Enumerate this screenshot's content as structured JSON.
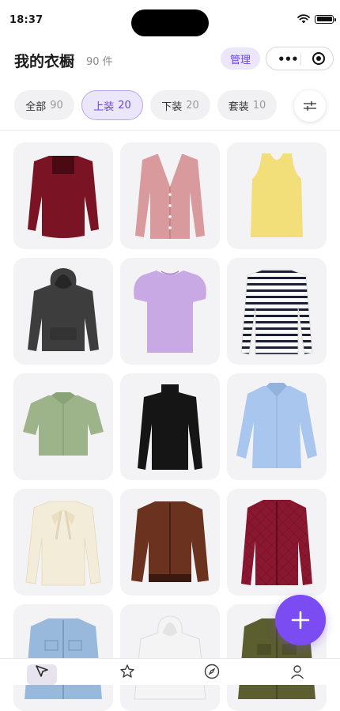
{
  "status": {
    "time": "18:37"
  },
  "header": {
    "title": "我的衣橱",
    "count": "90 件",
    "manage_label": "管理"
  },
  "tabs": [
    {
      "label": "全部",
      "count": "90"
    },
    {
      "label": "上装",
      "count": "20"
    },
    {
      "label": "下装",
      "count": "20"
    },
    {
      "label": "套装",
      "count": "10"
    }
  ],
  "active_tab": "上装",
  "items": [
    {
      "name": "burgundy-velvet-top-image",
      "color": "#7a1424"
    },
    {
      "name": "pink-knit-cardigan-image",
      "color": "#d99a9e"
    },
    {
      "name": "yellow-tank-top-image",
      "color": "#f3df7a"
    },
    {
      "name": "gray-hoodie-image",
      "color": "#3d3d3d"
    },
    {
      "name": "lavender-puff-sleeve-top-image",
      "color": "#c9a9e3"
    },
    {
      "name": "striped-long-sleeve-tee-image",
      "color": "#1b1f36"
    },
    {
      "name": "sage-green-shirt-image",
      "color": "#9db38a"
    },
    {
      "name": "black-turtleneck-image",
      "color": "#151515"
    },
    {
      "name": "light-blue-shirt-image",
      "color": "#a9c7ee"
    },
    {
      "name": "cream-bow-blouse-image",
      "color": "#f3ecd9"
    },
    {
      "name": "brown-bomber-jacket-image",
      "color": "#6b3220"
    },
    {
      "name": "burgundy-quilted-jacket-image",
      "color": "#8a1730"
    },
    {
      "name": "denim-jacket-image",
      "color": "#98b9dc"
    },
    {
      "name": "white-hoodie-image",
      "color": "#f4f4f4"
    },
    {
      "name": "olive-field-jacket-image",
      "color": "#5b5e2e"
    }
  ],
  "colors": {
    "accent": "#7b4cf2",
    "accent_soft": "#ece6fb",
    "card_bg": "#f3f3f5"
  },
  "tabbar": [
    {
      "icon": "wardrobe-icon",
      "active": true
    },
    {
      "icon": "star-icon"
    },
    {
      "icon": "compass-icon"
    },
    {
      "icon": "profile-icon"
    }
  ]
}
